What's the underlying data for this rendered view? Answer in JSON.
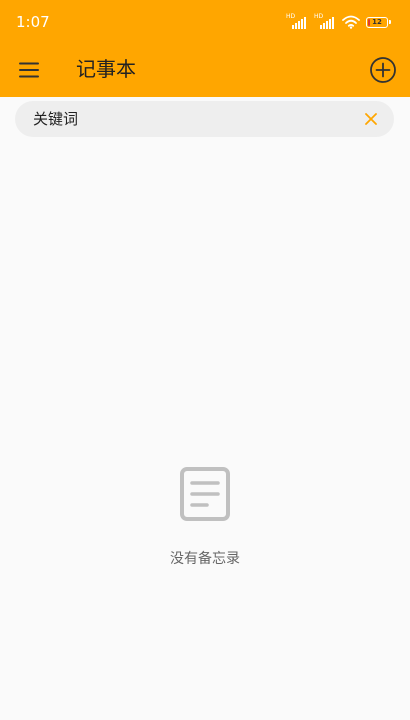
{
  "status_bar": {
    "time": "1:07",
    "battery_level": "12",
    "battery_fraction": 0.12
  },
  "app_bar": {
    "title": "记事本",
    "menu_icon": "menu-icon",
    "add_icon": "add-circle-icon"
  },
  "search": {
    "placeholder": "关键词",
    "value": "",
    "clear_icon": "close-icon"
  },
  "empty_state": {
    "icon": "note-icon",
    "message": "没有备忘录"
  },
  "colors": {
    "accent": "#FFA600",
    "background": "#fafafa",
    "search_background": "#eeeeee",
    "empty_icon": "#c0c0c0"
  }
}
